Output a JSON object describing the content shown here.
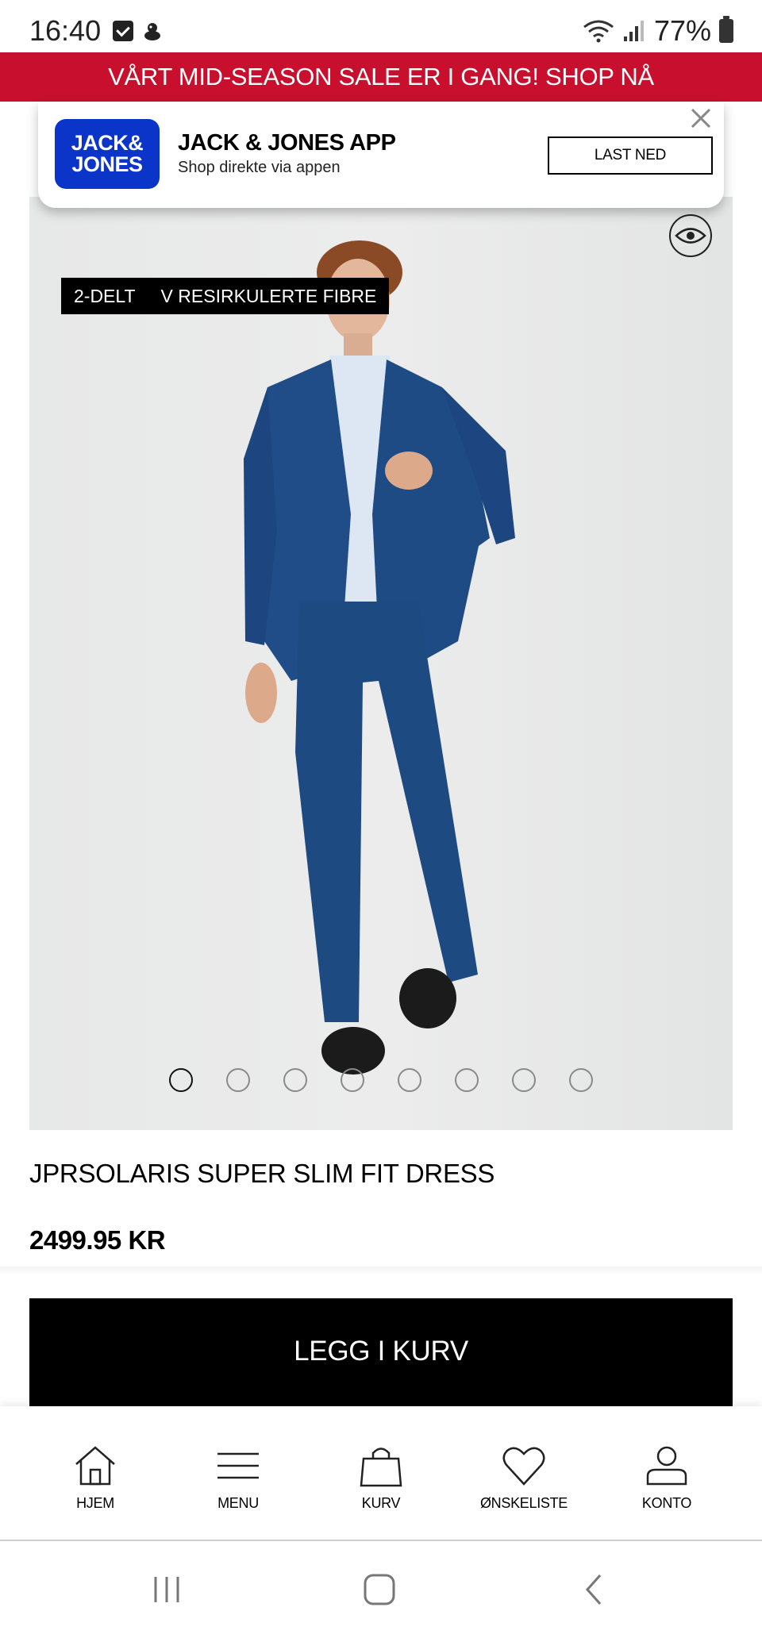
{
  "status_bar": {
    "time": "16:40",
    "battery_percent": "77%",
    "icons": [
      "check-icon",
      "notification-blob-icon",
      "wifi-icon",
      "signal-icon",
      "battery-icon"
    ]
  },
  "promo_banner": {
    "text": "VÅRT MID-SEASON SALE ER I GANG! SHOP NÅ",
    "background_color": "#c8102e"
  },
  "app_popup": {
    "logo_line1": "JACK&",
    "logo_line2": "JONES",
    "title": "JACK & JONES APP",
    "subtitle": "Shop direkte via appen",
    "button_label": "LAST NED",
    "logo_color": "#0b34c9"
  },
  "product": {
    "badge_1": "2-DELT",
    "badge_2": "V RESIRKULERTE FIBRE",
    "name": "JPRSOLARIS SUPER SLIM FIT DRESS",
    "price": "2499.95 KR",
    "image_count": 8,
    "active_image_index": 1
  },
  "add_to_cart_label": "LEGG I KURV",
  "bottom_nav": {
    "items": [
      {
        "label": "HJEM",
        "icon": "home-icon"
      },
      {
        "label": "MENU",
        "icon": "menu-icon"
      },
      {
        "label": "KURV",
        "icon": "bag-icon"
      },
      {
        "label": "ØNSKELISTE",
        "icon": "heart-icon"
      },
      {
        "label": "KONTO",
        "icon": "account-icon"
      }
    ]
  },
  "system_nav": {
    "buttons": [
      "recent-apps-icon",
      "home-circle-icon",
      "back-icon"
    ]
  }
}
